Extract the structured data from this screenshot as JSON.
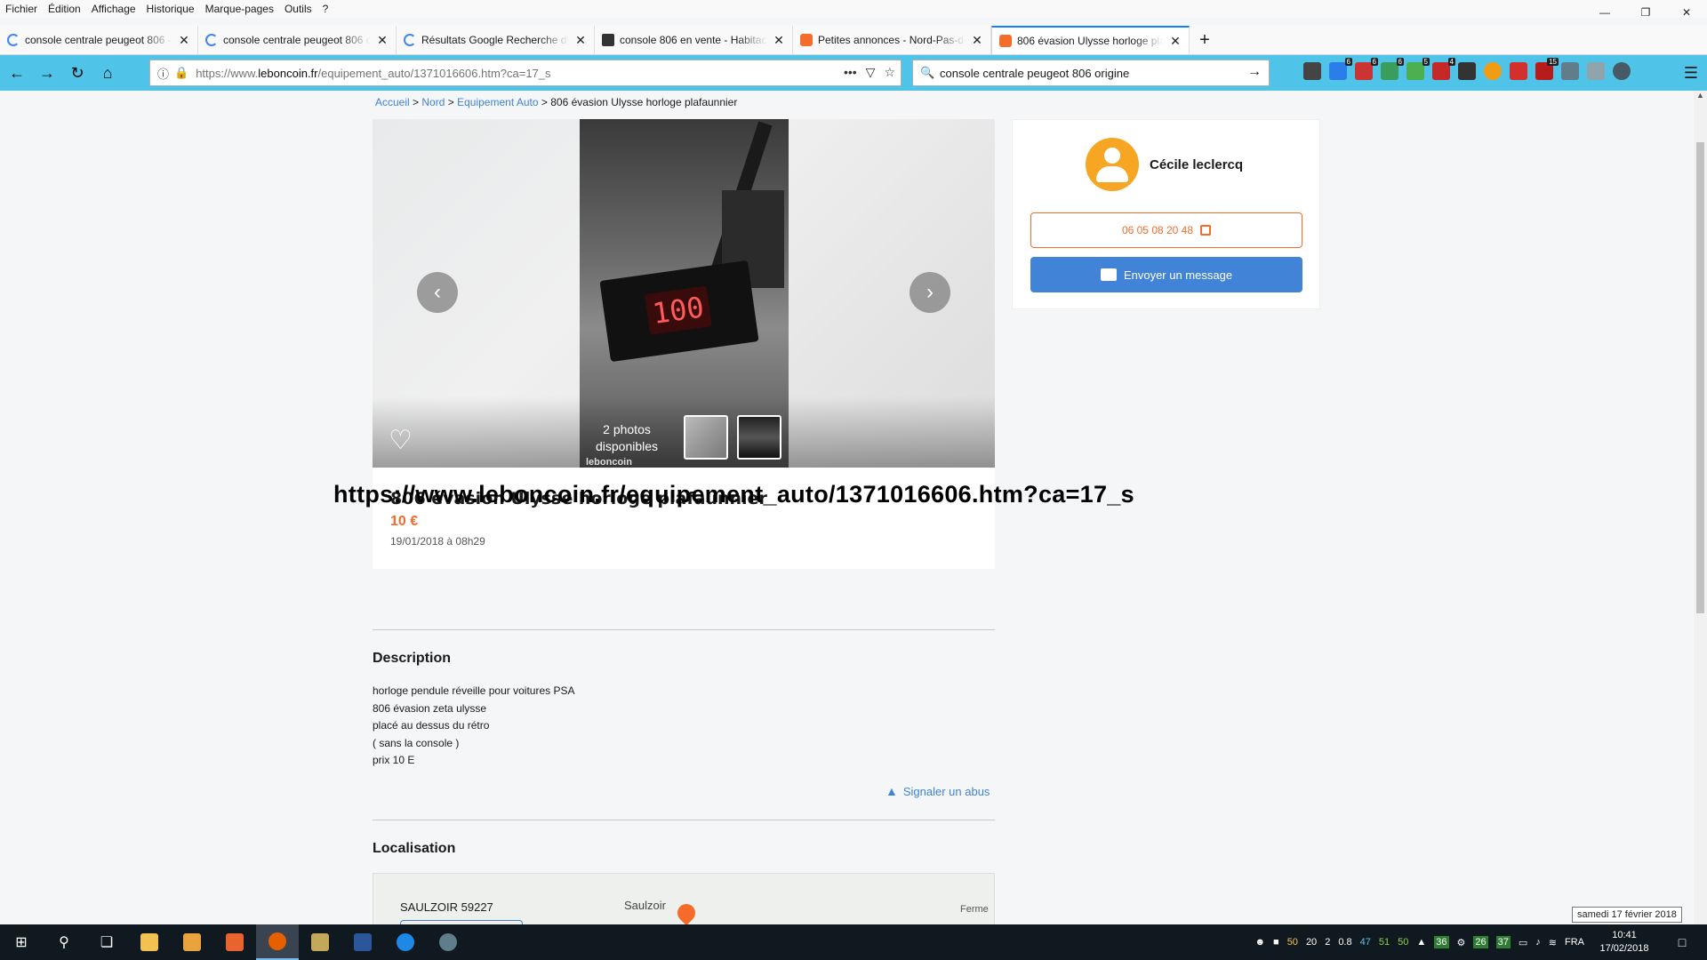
{
  "menu": [
    "Fichier",
    "Édition",
    "Affichage",
    "Historique",
    "Marque-pages",
    "Outils",
    "?"
  ],
  "tabs": [
    {
      "title": "console centrale peugeot 806 - ",
      "icon": "google"
    },
    {
      "title": "console centrale peugeot 806 o",
      "icon": "google"
    },
    {
      "title": "Résultats Google Recherche d'i",
      "icon": "google"
    },
    {
      "title": "console 806 en vente - Habitac",
      "icon": "house"
    },
    {
      "title": "Petites annonces - Nord-Pas-de",
      "icon": "leboncoin"
    },
    {
      "title": "806 évasion Ulysse horloge plaf",
      "icon": "leboncoin",
      "active": true
    }
  ],
  "nav": {
    "url_prefix": "https://www.",
    "url_host": "leboncoin.fr",
    "url_path": "/equipement_auto/1371016606.htm?ca=17_s",
    "search_value": "console centrale peugeot 806 origine"
  },
  "toolbar_badges": [
    "6",
    "6",
    "6",
    "5",
    "4",
    "15"
  ],
  "breadcrumb": {
    "home": "Accueil",
    "region": "Nord",
    "category": "Equipement Auto",
    "current": "806 évasion Ulysse horloge plafaunnier"
  },
  "gallery": {
    "clock_display": "100",
    "photo_count_line1": "2 photos",
    "photo_count_line2": "disponibles",
    "watermark": "leboncoin"
  },
  "ad": {
    "title": "806 évasion Ulysse horloge plafaunnier",
    "price": "10 €",
    "date": "19/01/2018 à 08h29"
  },
  "caption_url": "https://www.leboncoin.fr/equipement_auto/1371016606.htm?ca=17_s",
  "description": {
    "heading": "Description",
    "lines": [
      "horloge pendule réveille pour voitures PSA",
      "806 évasion zeta ulysse",
      "placé au dessus du rétro",
      "( sans la console )",
      "prix 10 E"
    ],
    "report": "Signaler un abus"
  },
  "location": {
    "heading": "Localisation",
    "city": "SAULZOIR 59227",
    "map_town": "Saulzoir",
    "map_ferme": "Ferme"
  },
  "seller": {
    "name": "Cécile leclercq",
    "phone": "06 05 08 20 48",
    "message_button": "Envoyer un message"
  },
  "date_tooltip": "samedi 17 février 2018",
  "taskbar": {
    "tray_numbers": [
      "50",
      "20",
      "2",
      "0.8",
      "47",
      "51",
      "50"
    ],
    "tray_badges": [
      "36",
      "26",
      "37"
    ],
    "lang": "FRA",
    "time": "10:41",
    "date": "17/02/2018"
  },
  "colors": {
    "brand_orange": "#f56b2a",
    "link_blue": "#4183d7",
    "navbar": "#4fc3e8"
  }
}
